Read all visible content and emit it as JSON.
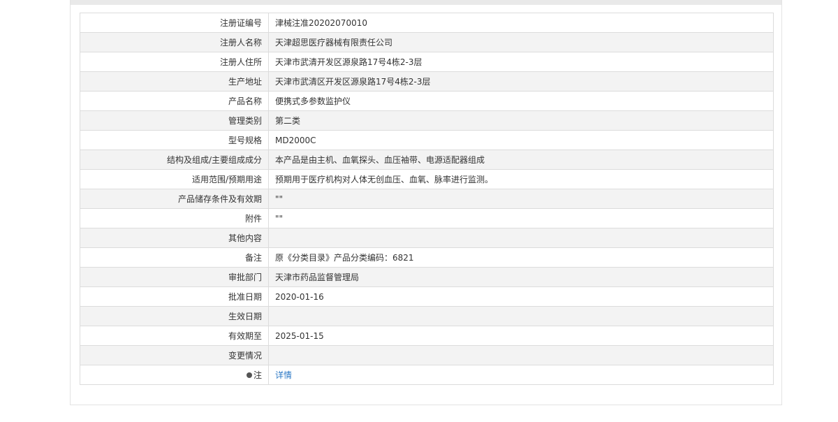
{
  "rows": [
    {
      "label": "注册证编号",
      "value": "津械注准20202070010"
    },
    {
      "label": "注册人名称",
      "value": "天津超思医疗器械有限责任公司"
    },
    {
      "label": "注册人住所",
      "value": "天津市武清开发区源泉路17号4栋2-3层"
    },
    {
      "label": "生产地址",
      "value": "天津市武清区开发区源泉路17号4栋2-3层"
    },
    {
      "label": "产品名称",
      "value": "便携式多参数监护仪"
    },
    {
      "label": "管理类别",
      "value": "第二类"
    },
    {
      "label": "型号规格",
      "value": "MD2000C"
    },
    {
      "label": "结构及组成/主要组成成分",
      "value": "本产品是由主机、血氧探头、血压袖带、电源适配器组成"
    },
    {
      "label": "适用范围/预期用途",
      "value": "预期用于医疗机构对人体无创血压、血氧、脉率进行监测。"
    },
    {
      "label": "产品储存条件及有效期",
      "value": "\"\""
    },
    {
      "label": "附件",
      "value": "\"\""
    },
    {
      "label": "其他内容",
      "value": ""
    },
    {
      "label": "备注",
      "value": "原《分类目录》产品分类编码：6821"
    },
    {
      "label": "审批部门",
      "value": "天津市药品监督管理局"
    },
    {
      "label": "批准日期",
      "value": "2020-01-16"
    },
    {
      "label": "生效日期",
      "value": ""
    },
    {
      "label": "有效期至",
      "value": "2025-01-15"
    },
    {
      "label": "变更情况",
      "value": ""
    }
  ],
  "note": {
    "label": "注",
    "icon": "lightbulb-icon",
    "link_text": "详情"
  }
}
